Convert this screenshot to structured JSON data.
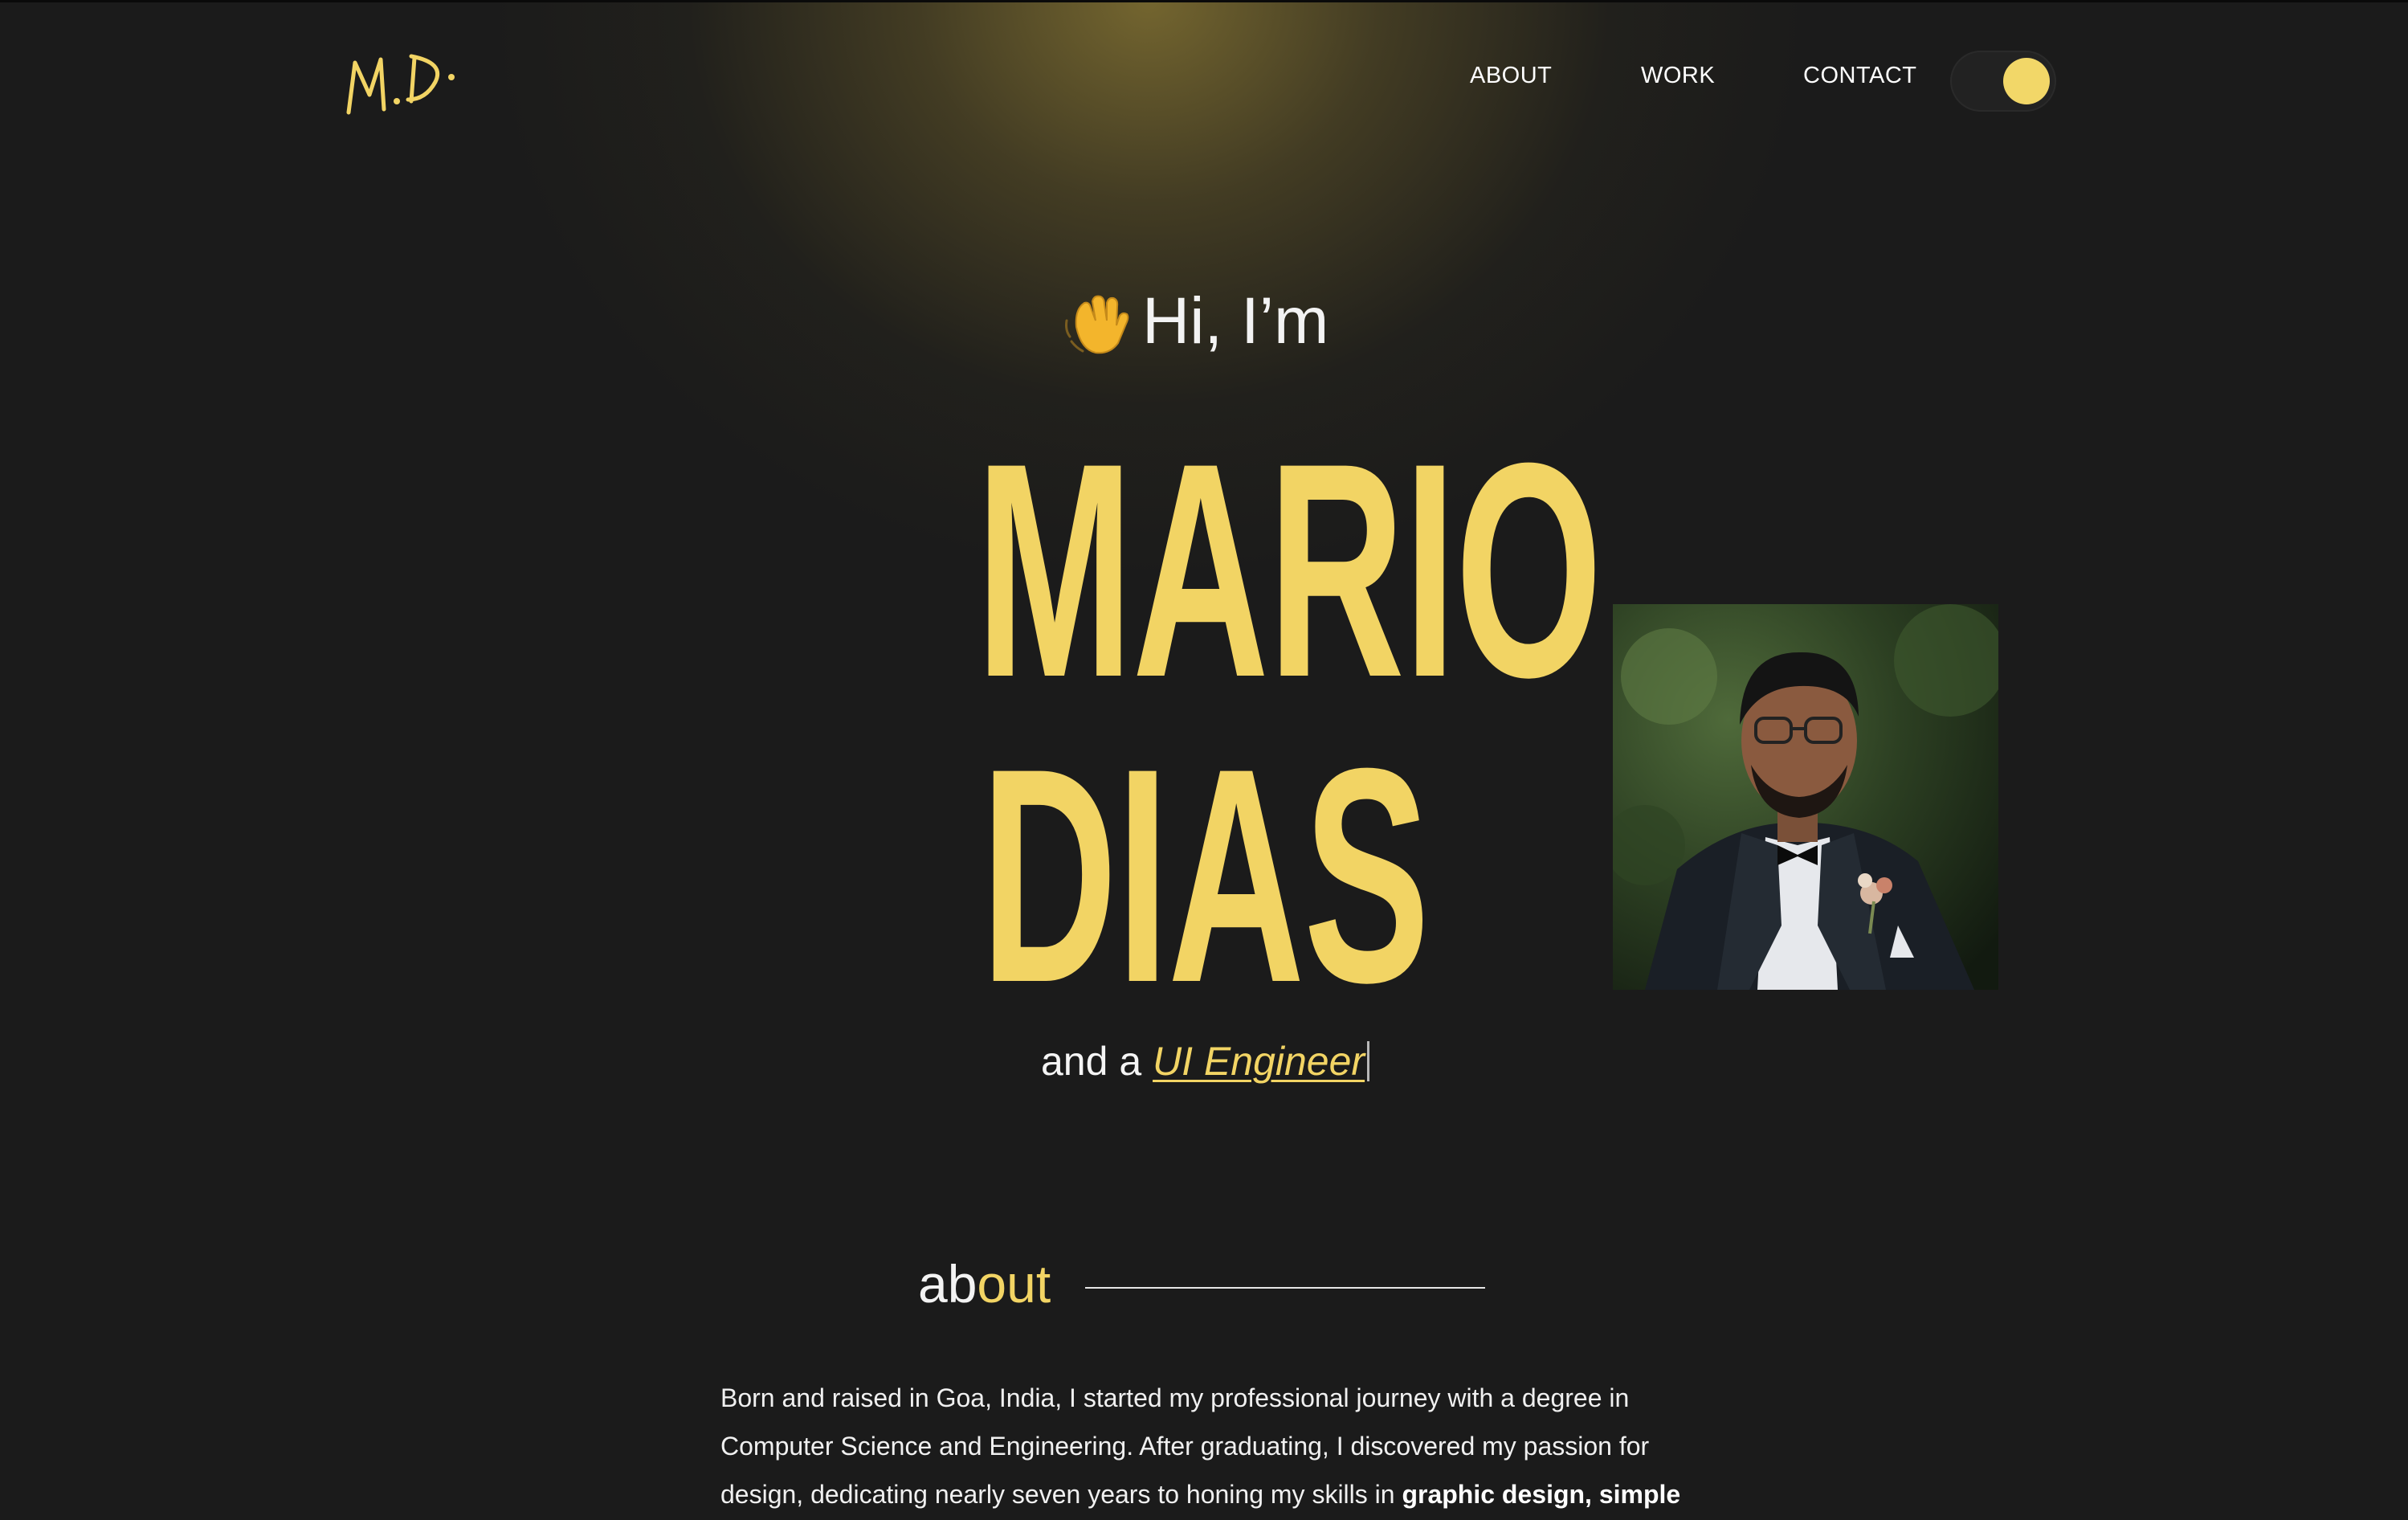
{
  "header": {
    "logo_text": "M.D.",
    "nav": {
      "about": "ABOUT",
      "work": "WORK",
      "contact": "CONTACT"
    },
    "theme_toggle": "dark-mode-toggle"
  },
  "hero": {
    "greeting": "Hi, I’m",
    "wave_icon": "waving-hand-icon",
    "first_name": "MARIO",
    "last_name": "DIAS",
    "tagline_prefix": "and a",
    "role": "UI Engineer"
  },
  "about": {
    "heading_start": "ab",
    "heading_accent": "out",
    "paragraph_lines": [
      "Born and raised in Goa, India, I started my professional journey with a degree in",
      "Computer Science and Engineering. After graduating, I discovered my passion for",
      "design, dedicating nearly seven years to honing my skills in "
    ],
    "bold_1": "graphic design",
    "separator": ", ",
    "bold_2": "simple"
  },
  "colors": {
    "background": "#1b1b1b",
    "accent": "#f2d464",
    "text": "#f2f2f2"
  }
}
